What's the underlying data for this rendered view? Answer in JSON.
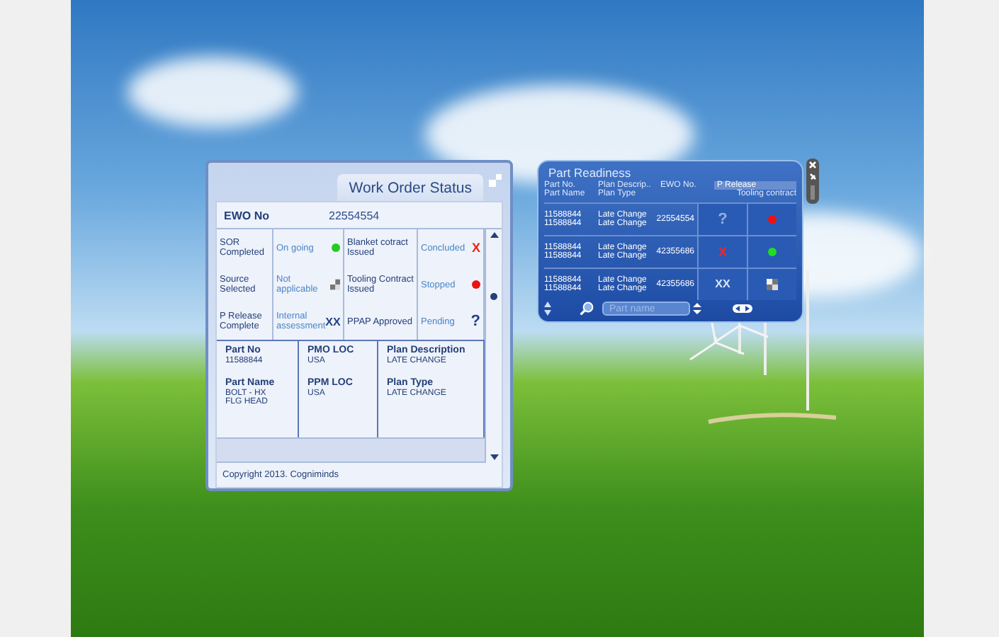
{
  "work_order": {
    "title": "Work Order Status",
    "ewo_label": "EWO No",
    "ewo_value": "22554554",
    "status_rows": [
      {
        "label": "SOR Completed",
        "status": "On going",
        "mark": {
          "kind": "dot",
          "color": "#22cc22"
        },
        "label2": "Blanket cotract Issued",
        "status2": "Concluded",
        "mark2": {
          "kind": "x",
          "text": "X"
        }
      },
      {
        "label": "Source Selected",
        "status": "Not applicable",
        "mark": {
          "kind": "checker"
        },
        "label2": "Tooling Contract Issued",
        "status2": "Stopped",
        "mark2": {
          "kind": "dot",
          "color": "#ee1111"
        }
      },
      {
        "label": "P Release Complete",
        "status": "Internal assessment",
        "mark": {
          "kind": "xx",
          "text": "XX"
        },
        "label2": "PPAP Approved",
        "status2": "Pending",
        "mark2": {
          "kind": "question",
          "text": "?"
        }
      }
    ],
    "details": [
      {
        "heading": "Part No",
        "value": "11588844",
        "heading2": "Part Name",
        "value2": "BOLT - HX FLG HEAD"
      },
      {
        "heading": "PMO LOC",
        "value": "USA",
        "heading2": "PPM LOC",
        "value2": "USA"
      },
      {
        "heading": "Plan Description",
        "value": "LATE CHANGE",
        "heading2": "Plan Type",
        "value2": "LATE CHANGE"
      }
    ],
    "copyright": "Copyright 2013. Cogniminds"
  },
  "part_readiness": {
    "title": "Part Readiness",
    "headers": {
      "part_no": "Part No.",
      "part_name": "Part Name",
      "plan_desc": "Plan Descrip..",
      "plan_type": "Plan Type",
      "ewo": "EWO No.",
      "p_release": "P Release",
      "tooling": "Tooling contract"
    },
    "rows": [
      {
        "part_no": "11588844",
        "part_name": "11588844",
        "plan_desc": "Late Change",
        "plan_type": "Late Change",
        "ewo": "22554554",
        "p_release": {
          "kind": "question",
          "text": "?"
        },
        "tooling": {
          "kind": "dot",
          "color": "#ee1111"
        }
      },
      {
        "part_no": "11588844",
        "part_name": "11588844",
        "plan_desc": "Late Change",
        "plan_type": "Late Change",
        "ewo": "42355686",
        "p_release": {
          "kind": "x",
          "text": "X"
        },
        "tooling": {
          "kind": "dot",
          "color": "#22dd22"
        }
      },
      {
        "part_no": "11588844",
        "part_name": "11588844",
        "plan_desc": "Late Change",
        "plan_type": "Late Change",
        "ewo": "42355686",
        "p_release": {
          "kind": "xx",
          "text": "XX"
        },
        "tooling": {
          "kind": "checker"
        }
      }
    ],
    "search": {
      "placeholder": "Part name"
    }
  }
}
